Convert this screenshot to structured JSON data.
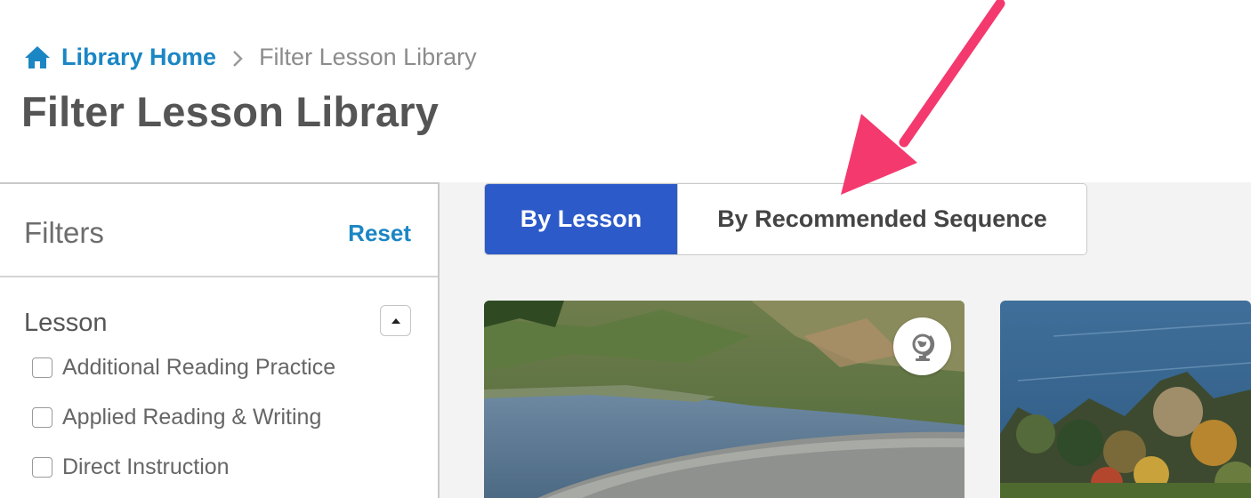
{
  "breadcrumb": {
    "home_label": "Library Home",
    "current_label": "Filter Lesson Library"
  },
  "page": {
    "title": "Filter Lesson Library"
  },
  "sidebar": {
    "title": "Filters",
    "reset_label": "Reset",
    "section": {
      "label": "Lesson",
      "options": [
        {
          "label": "Additional Reading Practice",
          "checked": false
        },
        {
          "label": "Applied Reading & Writing",
          "checked": false
        },
        {
          "label": "Direct Instruction",
          "checked": false
        }
      ]
    }
  },
  "view_toggle": {
    "by_lesson_label": "By Lesson",
    "by_sequence_label": "By Recommended Sequence",
    "active": "By Lesson"
  },
  "icons": {
    "home": "home-icon",
    "separator": "chevron-right-icon",
    "collapse": "caret-up-icon",
    "badge": "globe-icon"
  },
  "colors": {
    "link": "#1b86c4",
    "active_tab": "#2d5ac9",
    "annotation_arrow": "#f4396e"
  }
}
